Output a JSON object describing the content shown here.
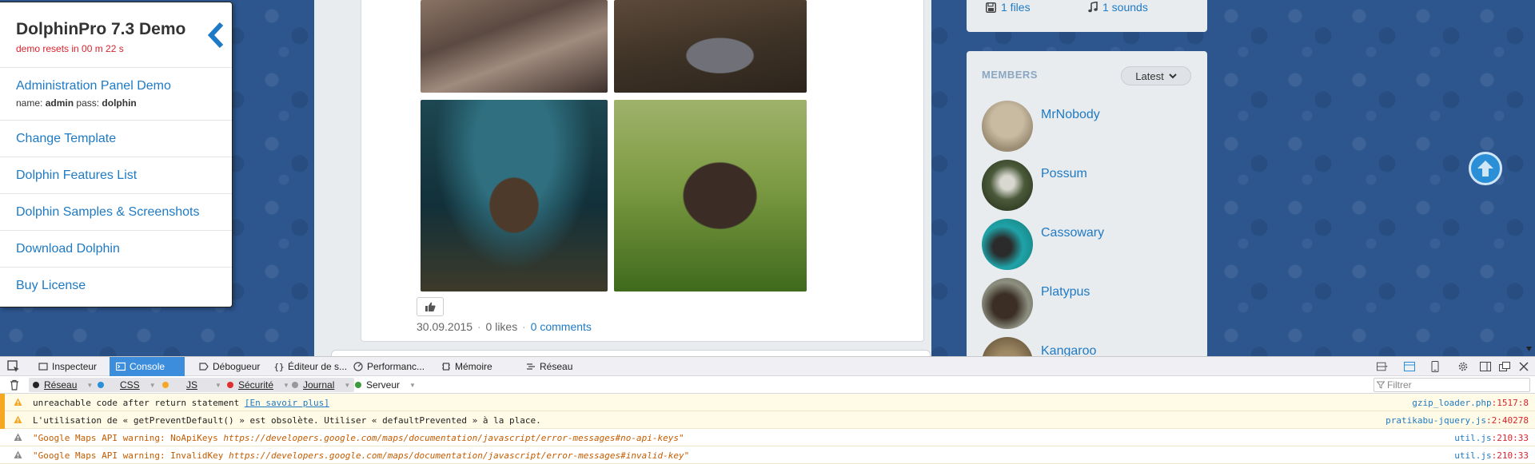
{
  "demo_panel": {
    "title": "DolphinPro 7.3 Demo",
    "reset_notice": "demo resets in 00 m 22 s",
    "admin_link": "Administration Panel Demo",
    "creds_name_label": "name:",
    "creds_name": "admin",
    "creds_pass_label": "pass:",
    "creds_pass": "dolphin",
    "links": [
      "Change Template",
      "Dolphin Features List",
      "Dolphin Samples & Screenshots",
      "Download Dolphin",
      "Buy License"
    ]
  },
  "post": {
    "date": "30.09.2015",
    "likes": "0 likes",
    "separator": "·",
    "comments": "0 comments",
    "photos": [
      "platypus-photo-1",
      "platypus-photo-2",
      "platypus-photo-3",
      "platypus-photo-4"
    ]
  },
  "files_box": {
    "files": "1 files",
    "sounds": "1 sounds"
  },
  "members": {
    "title": "MEMBERS",
    "sort_label": "Latest",
    "list": [
      {
        "name": "MrNobody",
        "avatar_color": "#b7a98f"
      },
      {
        "name": "Possum",
        "avatar_color": "#4b5a3a"
      },
      {
        "name": "Cassowary",
        "avatar_color": "#1fa3a8"
      },
      {
        "name": "Platypus",
        "avatar_color": "#5a4a3b"
      },
      {
        "name": "Kangaroo",
        "avatar_color": "#8e7a5a"
      }
    ]
  },
  "devtools": {
    "tabs": [
      {
        "label": "Inspecteur",
        "icon": "inspector-icon"
      },
      {
        "label": "Console",
        "icon": "console-icon",
        "active": true
      },
      {
        "label": "Débogueur",
        "icon": "debugger-icon"
      },
      {
        "label": "Éditeur de s...",
        "icon": "style-editor-icon"
      },
      {
        "label": "Performanc...",
        "icon": "performance-icon"
      },
      {
        "label": "Mémoire",
        "icon": "memory-icon"
      },
      {
        "label": "Réseau",
        "icon": "network-icon"
      }
    ],
    "filters": [
      {
        "label": "Réseau",
        "color": "#222222"
      },
      {
        "label": "CSS",
        "color": "#2a8fd6"
      },
      {
        "label": "JS",
        "color": "#f5a623"
      },
      {
        "label": "Sécurité",
        "color": "#e0302e"
      },
      {
        "label": "Journal",
        "color": "#999999"
      },
      {
        "label": "Serveur",
        "color": "#3c9c3c"
      }
    ],
    "filter_placeholder": "Filtrer",
    "messages": [
      {
        "text": "unreachable code after return statement ",
        "link": "[En savoir plus]",
        "source": "gzip_loader.php",
        "line": ":1517:8",
        "style": "warn"
      },
      {
        "text": "L'utilisation de « getPreventDefault() » est obsolète. Utiliser « defaultPrevented » à la place.",
        "source": "pratikabu-jquery.js",
        "line": ":2:40278",
        "style": "warn"
      },
      {
        "text": "\"Google Maps API warning: NoApiKeys ",
        "italic": "https://developers.google.com/maps/documentation/javascript/error-messages#no-api-keys",
        "tail": "\"",
        "source": "util.js",
        "line": ":210:33",
        "style": "orange"
      },
      {
        "text": "\"Google Maps API warning: InvalidKey ",
        "italic": "https://developers.google.com/maps/documentation/javascript/error-messages#invalid-key",
        "tail": "\"",
        "source": "util.js",
        "line": ":210:33",
        "style": "orange"
      }
    ]
  },
  "colors": {
    "link": "#1e7ac4",
    "alert_red": "#d9232d",
    "page_bg": "#2d568f",
    "devtools_active_tab": "#3c8ddc"
  }
}
